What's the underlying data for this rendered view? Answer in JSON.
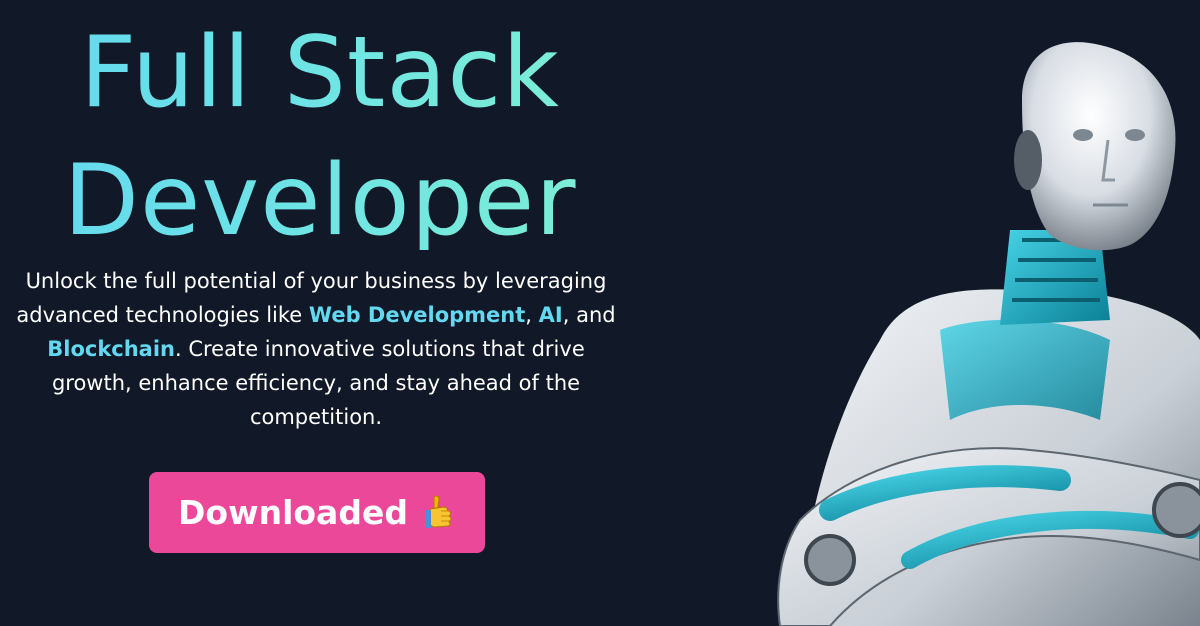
{
  "hero": {
    "title_line_1": "Full Stack",
    "title_line_2": "Developer",
    "description": {
      "part_1": "Unlock the full potential of your business by leveraging advanced technologies like ",
      "highlight_1": "Web Development",
      "sep_1": ", ",
      "highlight_2": "AI",
      "sep_2": ", and ",
      "highlight_3": "Blockchain",
      "part_2": ". Create innovative solutions that drive growth, enhance efficiency, and stay ahead of the competition."
    },
    "cta_label": "Downloaded",
    "cta_icon": "thumbs-up-icon"
  },
  "illustration": {
    "subject": "robot-illustration"
  },
  "colors": {
    "background": "#111827",
    "title_gradient_start": "#62d9f0",
    "title_gradient_end": "#7ff0d2",
    "highlight": "#62d9f0",
    "button": "#ec4899",
    "text": "#ffffff"
  }
}
